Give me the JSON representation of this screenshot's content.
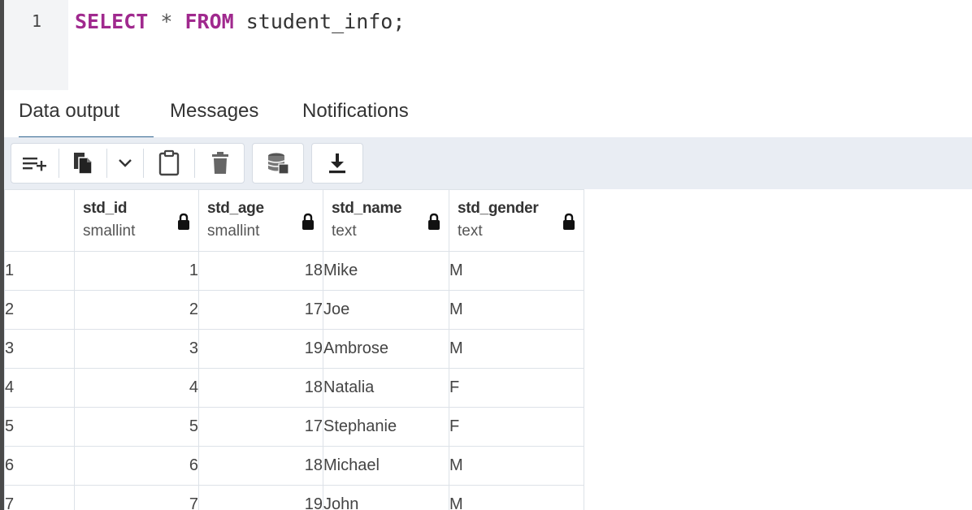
{
  "editor": {
    "line_number": "1",
    "tokens": {
      "select": "SELECT",
      "star": " * ",
      "from": "FROM",
      "rest": " student_info;"
    }
  },
  "tabs": [
    {
      "label": "Data output",
      "active": true
    },
    {
      "label": "Messages",
      "active": false
    },
    {
      "label": "Notifications",
      "active": false
    }
  ],
  "toolbar": {
    "buttons": [
      "add-row-icon",
      "copy-icon",
      "chevron-down-icon",
      "paste-icon",
      "delete-icon",
      "save-data-icon",
      "download-icon"
    ]
  },
  "grid": {
    "columns": [
      {
        "name": "std_id",
        "type": "smallint"
      },
      {
        "name": "std_age",
        "type": "smallint"
      },
      {
        "name": "std_name",
        "type": "text"
      },
      {
        "name": "std_gender",
        "type": "text"
      }
    ],
    "rows": [
      {
        "n": "1",
        "id": "1",
        "age": "18",
        "name": "Mike",
        "gender": "M"
      },
      {
        "n": "2",
        "id": "2",
        "age": "17",
        "name": "Joe",
        "gender": "M"
      },
      {
        "n": "3",
        "id": "3",
        "age": "19",
        "name": "Ambrose",
        "gender": "M"
      },
      {
        "n": "4",
        "id": "4",
        "age": "18",
        "name": "Natalia",
        "gender": "F"
      },
      {
        "n": "5",
        "id": "5",
        "age": "17",
        "name": "Stephanie",
        "gender": "F"
      },
      {
        "n": "6",
        "id": "6",
        "age": "18",
        "name": "Michael",
        "gender": "M"
      },
      {
        "n": "7",
        "id": "7",
        "age": "19",
        "name": "John",
        "gender": "M"
      }
    ]
  },
  "colors": {
    "keyword": "#a0298e",
    "active_tab_underline": "#326690",
    "toolbar_bg": "#e9edf3"
  }
}
